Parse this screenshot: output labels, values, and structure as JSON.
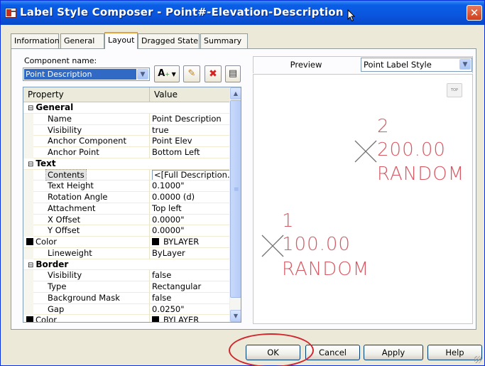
{
  "window": {
    "title": "Label Style Composer - Point#-Elevation-Description",
    "close_glyph": "✕"
  },
  "tabs": [
    {
      "label": "Information"
    },
    {
      "label": "General"
    },
    {
      "label": "Layout",
      "active": true
    },
    {
      "label": "Dragged State"
    },
    {
      "label": "Summary"
    }
  ],
  "component": {
    "label": "Component name:",
    "value": "Point Description"
  },
  "toolbar": {
    "insert_glyph": "A",
    "insert_sub": "+",
    "copy_glyph": "✎",
    "delete_glyph": "✖",
    "move_glyph": "▤"
  },
  "grid": {
    "header_property": "Property",
    "header_value": "Value",
    "rows": [
      {
        "kind": "category",
        "toggle": "⊟",
        "name": "General",
        "value": ""
      },
      {
        "kind": "prop",
        "name": "Name",
        "value": "Point Description"
      },
      {
        "kind": "prop",
        "name": "Visibility",
        "value": "true"
      },
      {
        "kind": "prop",
        "name": "Anchor Component",
        "value": "Point Elev"
      },
      {
        "kind": "prop",
        "name": "Anchor Point",
        "value": "Bottom Left"
      },
      {
        "kind": "category",
        "toggle": "⊟",
        "name": "Text",
        "value": ""
      },
      {
        "kind": "prop",
        "name": "Contents",
        "value": "<[Full Description...",
        "selected": true
      },
      {
        "kind": "prop",
        "name": "Text Height",
        "value": "0.1000\""
      },
      {
        "kind": "prop",
        "name": "Rotation Angle",
        "value": "0.0000 (d)"
      },
      {
        "kind": "prop",
        "name": "Attachment",
        "value": "Top left"
      },
      {
        "kind": "prop",
        "name": "X Offset",
        "value": "0.0000\""
      },
      {
        "kind": "prop",
        "name": "Y Offset",
        "value": "0.0000\""
      },
      {
        "kind": "color",
        "name": "Color",
        "value": "BYLAYER"
      },
      {
        "kind": "prop",
        "name": "Lineweight",
        "value": "ByLayer"
      },
      {
        "kind": "category",
        "toggle": "⊟",
        "name": "Border",
        "value": ""
      },
      {
        "kind": "prop",
        "name": "Visibility",
        "value": "false"
      },
      {
        "kind": "prop",
        "name": "Type",
        "value": "Rectangular"
      },
      {
        "kind": "prop",
        "name": "Background Mask",
        "value": "false"
      },
      {
        "kind": "prop",
        "name": "Gap",
        "value": "0.0250\""
      },
      {
        "kind": "color",
        "name": "Color",
        "value": "BYLAYER"
      }
    ]
  },
  "preview": {
    "label": "Preview",
    "style_value": "Point Label Style",
    "top_view": "TOP",
    "label_color": "#d44a56",
    "points": [
      {
        "number": "2",
        "elevation": "200.00",
        "description": "RANDOM"
      },
      {
        "number": "1",
        "elevation": "100.00",
        "description": "RANDOM"
      }
    ]
  },
  "buttons": {
    "ok": "OK",
    "cancel": "Cancel",
    "apply": "Apply",
    "help": "Help"
  }
}
